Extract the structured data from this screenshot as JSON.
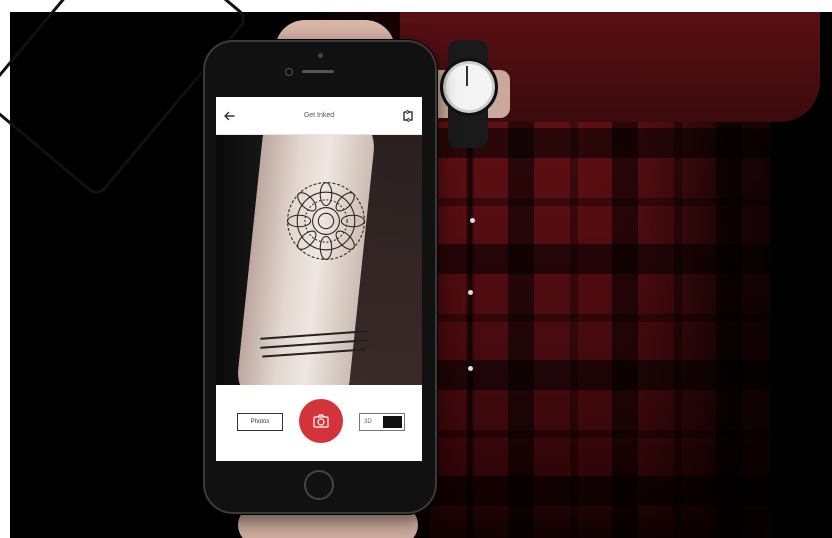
{
  "app": {
    "title": "Get Inked"
  },
  "controls": {
    "photos_label": "Photos",
    "mode_label": "3D",
    "mode_enabled": true
  },
  "icons": {
    "back": "arrow-left-icon",
    "flip": "camera-flip-icon",
    "shutter": "camera-icon"
  },
  "colors": {
    "accent": "#d5333a",
    "shirt": "#5a1015",
    "phone_body": "#111111"
  }
}
